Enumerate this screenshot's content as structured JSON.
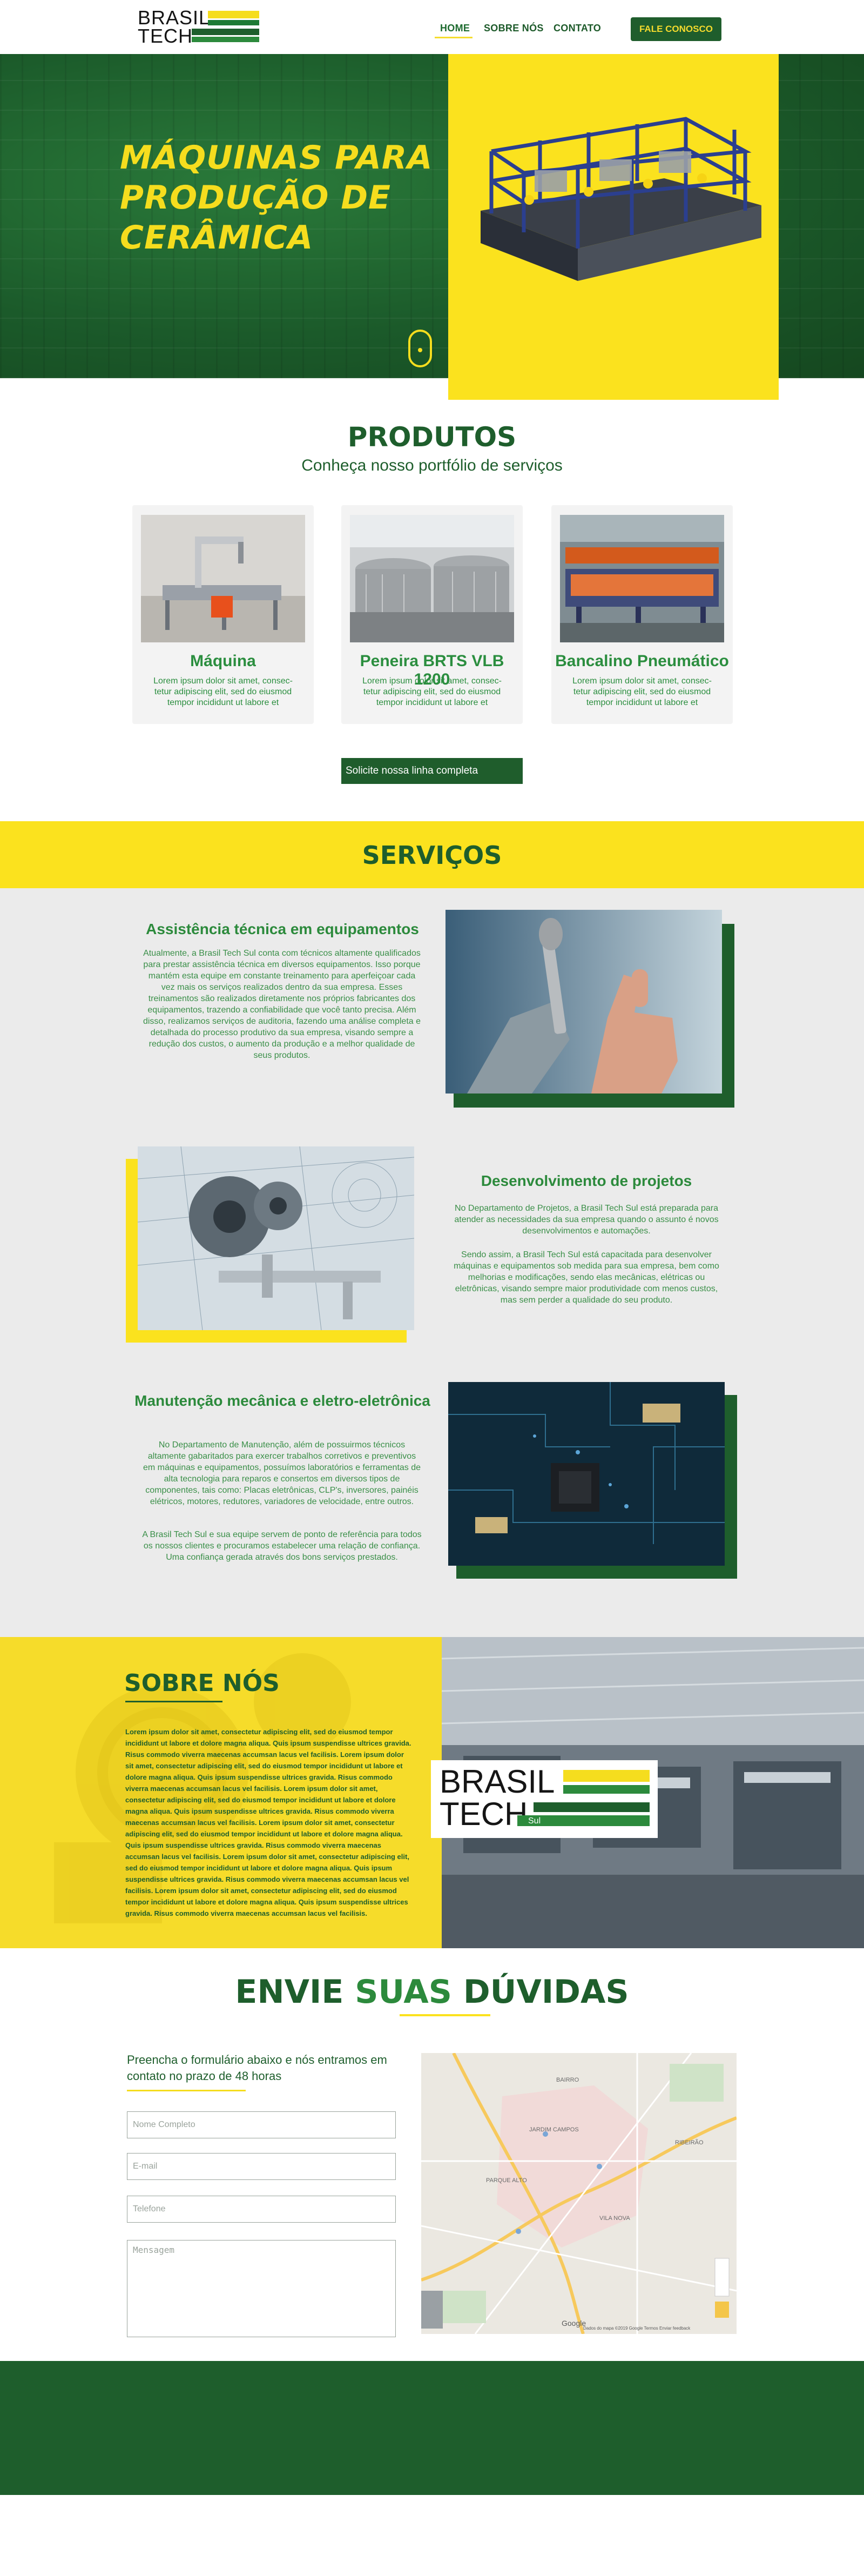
{
  "brand": {
    "name_line1": "BRASIL",
    "name_line2": "TECH",
    "name_tag": "Sul",
    "green": "#1e5e2c",
    "yellow": "#fbe21e"
  },
  "nav": {
    "items": [
      {
        "label": "HOME",
        "active": true
      },
      {
        "label": "SOBRE NÓS",
        "active": false
      },
      {
        "label": "CONTATO",
        "active": false
      }
    ],
    "cta": "FALE CONOSCO"
  },
  "hero": {
    "title_line1": "MÁQUINAS PARA",
    "title_line2": "PRODUÇÃO DE",
    "title_line3": "CERÂMICA",
    "scroll_icon": "mouse-scroll-icon"
  },
  "produtos": {
    "title": "PRODUTOS",
    "subtitle": "Conheça nosso portfólio de serviços",
    "items": [
      {
        "name": "Máquina",
        "desc": "Lorem ipsum dolor sit amet, consec-tetur adipiscing elit, sed do eiusmod tempor incididunt ut labore et"
      },
      {
        "name": "Peneira BRTS VLB 1200",
        "desc": "Lorem ipsum dolor sit amet, consec-tetur adipiscing elit, sed do eiusmod tempor incididunt ut labore et"
      },
      {
        "name": "Bancalino Pneumático",
        "desc": "Lorem ipsum dolor sit amet, consec-tetur adipiscing elit, sed do eiusmod tempor incididunt ut labore et"
      }
    ],
    "button": "Solicite nossa linha completa"
  },
  "servicos": {
    "title": "SERVIÇOS",
    "items": [
      {
        "title": "Assistência técnica em equipamentos",
        "text": "Atualmente, a Brasil Tech Sul conta com técnicos altamente qualificados para prestar assistência técnica em diversos equipamentos. Isso porque mantém esta equipe em constante treinamento para aperfeiçoar cada vez mais os serviços realizados dentro da sua empresa. Esses treinamentos são realizados diretamente nos próprios fabricantes dos equipamentos, trazendo a confiabilidade que você tanto precisa. Além disso, realizamos serviços de auditoria, fazendo uma análise completa e detalhada do processo produtivo da sua empresa, visando sempre a redução dos custos, o aumento da produção e a melhor qualidade de seus produtos."
      },
      {
        "title": "Desenvolvimento de projetos",
        "text": "No Departamento de Projetos, a Brasil Tech Sul está preparada para atender as necessidades da sua empresa quando o assunto é novos desenvolvimentos e automações.",
        "text2": "Sendo assim, a Brasil Tech Sul está capacitada para desenvolver máquinas e equipamentos sob medida para sua empresa, bem como melhorias e modificações, sendo elas mecânicas, elétricas ou eletrônicas, visando sempre maior produtividade com menos custos, mas sem perder a qualidade do seu produto."
      },
      {
        "title": "Manutenção mecânica e eletro-eletrônica",
        "text": "No Departamento de Manutenção, além de possuirmos técnicos altamente gabaritados para exercer trabalhos corretivos e preventivos em máquinas e equipamentos, possuímos laboratórios e ferramentas de alta tecnologia para reparos e consertos em diversos tipos de componentes, tais como: Placas eletrônicas, CLP's, inversores, painéis elétricos, motores, redutores, variadores de velocidade, entre outros.",
        "text2": "A Brasil Tech Sul e sua equipe servem de ponto de referência para todos os nossos clientes e procuramos estabelecer uma relação de confiança. Uma confiança gerada através dos bons serviços prestados."
      }
    ]
  },
  "sobre": {
    "title": "SOBRE NÓS",
    "text": "Lorem ipsum dolor sit amet, consectetur adipiscing elit, sed do eiusmod tempor incididunt ut labore et dolore magna aliqua. Quis ipsum suspendisse ultrices gravida. Risus commodo viverra maecenas accumsan lacus vel facilisis. Lorem ipsum dolor sit amet, consectetur adipiscing elit, sed do eiusmod tempor incididunt ut labore et dolore magna aliqua. Quis ipsum suspendisse ultrices gravida. Risus commodo viverra maecenas accumsan lacus vel facilisis. Lorem ipsum dolor sit amet, consectetur adipiscing elit, sed do eiusmod tempor incididunt ut labore et dolore magna aliqua. Quis ipsum suspendisse ultrices gravida. Risus commodo viverra maecenas accumsan lacus vel facilisis. Lorem ipsum dolor sit amet, consectetur adipiscing elit, sed do eiusmod tempor incididunt ut labore et dolore magna aliqua. Quis ipsum suspendisse ultrices gravida. Risus commodo viverra maecenas accumsan lacus vel facilisis. Lorem ipsum dolor sit amet, consectetur adipiscing elit, sed do eiusmod tempor incididunt ut labore et dolore magna aliqua. Quis ipsum suspendisse ultrices gravida. Risus commodo viverra maecenas accumsan lacus vel facilisis. Lorem ipsum dolor sit amet, consectetur adipiscing elit, sed do eiusmod tempor incididunt ut labore et dolore magna aliqua. Quis ipsum suspendisse ultrices gravida. Risus commodo viverra maecenas accumsan lacus vel facilisis."
  },
  "duvidas": {
    "title_part1": "ENVIE",
    "title_part2": "SUAS",
    "title_part3": "DÚVIDAS",
    "intro": "Preencha o formulário abaixo e nós entramos em contato no prazo de 48 horas",
    "fields": {
      "nome": "Nome Completo",
      "email": "E-mail",
      "telefone": "Telefone",
      "mensagem": "Mensagem"
    },
    "map": {
      "labels": [
        "BAIRRO",
        "JARDIM CAMPOS",
        "PARQUE ALTO",
        "VILA NOVA",
        "RIBEIRÃO"
      ],
      "google": "Google",
      "footer": "Dados do mapa ©2019 Google   Termos   Enviar feedback"
    }
  }
}
